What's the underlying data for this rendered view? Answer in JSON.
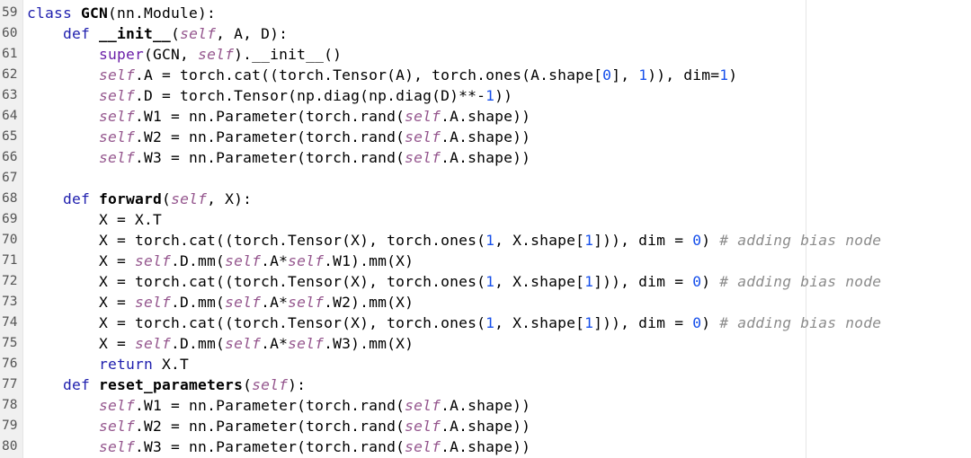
{
  "editor": {
    "language": "python",
    "colors": {
      "keyword": "#1f1fae",
      "builtin": "#6b1fa8",
      "self": "#94558d",
      "number": "#1750eb",
      "comment": "#8c8c8c",
      "text": "#000000",
      "gutter": "#f0f0f0"
    },
    "lines": [
      {
        "no": "59",
        "tokens": [
          [
            "kw",
            "class "
          ],
          [
            "fn",
            "GCN"
          ],
          [
            "pl",
            "(nn.Module):"
          ]
        ]
      },
      {
        "no": "60",
        "tokens": [
          [
            "pl",
            "    "
          ],
          [
            "kw",
            "def "
          ],
          [
            "fn",
            "__init__"
          ],
          [
            "pl",
            "("
          ],
          [
            "sf",
            "self"
          ],
          [
            "pl",
            ", A, D):"
          ]
        ]
      },
      {
        "no": "61",
        "tokens": [
          [
            "pl",
            "        "
          ],
          [
            "bf",
            "super"
          ],
          [
            "pl",
            "(GCN, "
          ],
          [
            "sf",
            "self"
          ],
          [
            "pl",
            ").__init__()"
          ]
        ]
      },
      {
        "no": "62",
        "tokens": [
          [
            "pl",
            "        "
          ],
          [
            "sf",
            "self"
          ],
          [
            "pl",
            ".A = torch.cat((torch.Tensor(A), torch.ones(A.shape["
          ],
          [
            "nm",
            "0"
          ],
          [
            "pl",
            "], "
          ],
          [
            "nm",
            "1"
          ],
          [
            "pl",
            ")), dim="
          ],
          [
            "nm",
            "1"
          ],
          [
            "pl",
            ")"
          ]
        ]
      },
      {
        "no": "63",
        "tokens": [
          [
            "pl",
            "        "
          ],
          [
            "sf",
            "self"
          ],
          [
            "pl",
            ".D = torch.Tensor(np.diag(np.diag(D)**-"
          ],
          [
            "nm",
            "1"
          ],
          [
            "pl",
            "))"
          ]
        ]
      },
      {
        "no": "64",
        "tokens": [
          [
            "pl",
            "        "
          ],
          [
            "sf",
            "self"
          ],
          [
            "pl",
            ".W1 = nn.Parameter(torch.rand("
          ],
          [
            "sf",
            "self"
          ],
          [
            "pl",
            ".A.shape))"
          ]
        ]
      },
      {
        "no": "65",
        "tokens": [
          [
            "pl",
            "        "
          ],
          [
            "sf",
            "self"
          ],
          [
            "pl",
            ".W2 = nn.Parameter(torch.rand("
          ],
          [
            "sf",
            "self"
          ],
          [
            "pl",
            ".A.shape))"
          ]
        ]
      },
      {
        "no": "66",
        "tokens": [
          [
            "pl",
            "        "
          ],
          [
            "sf",
            "self"
          ],
          [
            "pl",
            ".W3 = nn.Parameter(torch.rand("
          ],
          [
            "sf",
            "self"
          ],
          [
            "pl",
            ".A.shape))"
          ]
        ]
      },
      {
        "no": "67",
        "tokens": []
      },
      {
        "no": "68",
        "tokens": [
          [
            "pl",
            "    "
          ],
          [
            "kw",
            "def "
          ],
          [
            "fn",
            "forward"
          ],
          [
            "pl",
            "("
          ],
          [
            "sf",
            "self"
          ],
          [
            "pl",
            ", X):"
          ]
        ]
      },
      {
        "no": "69",
        "tokens": [
          [
            "pl",
            "        X = X.T"
          ]
        ]
      },
      {
        "no": "70",
        "tokens": [
          [
            "pl",
            "        X = torch.cat((torch.Tensor(X), torch.ones("
          ],
          [
            "nm",
            "1"
          ],
          [
            "pl",
            ", X.shape["
          ],
          [
            "nm",
            "1"
          ],
          [
            "pl",
            "])), dim = "
          ],
          [
            "nm",
            "0"
          ],
          [
            "pl",
            ") "
          ],
          [
            "cm",
            "# adding bias node"
          ]
        ]
      },
      {
        "no": "71",
        "tokens": [
          [
            "pl",
            "        X = "
          ],
          [
            "sf",
            "self"
          ],
          [
            "pl",
            ".D.mm("
          ],
          [
            "sf",
            "self"
          ],
          [
            "pl",
            ".A*"
          ],
          [
            "sf",
            "self"
          ],
          [
            "pl",
            ".W1).mm(X)"
          ]
        ]
      },
      {
        "no": "72",
        "tokens": [
          [
            "pl",
            "        X = torch.cat((torch.Tensor(X), torch.ones("
          ],
          [
            "nm",
            "1"
          ],
          [
            "pl",
            ", X.shape["
          ],
          [
            "nm",
            "1"
          ],
          [
            "pl",
            "])), dim = "
          ],
          [
            "nm",
            "0"
          ],
          [
            "pl",
            ") "
          ],
          [
            "cm",
            "# adding bias node"
          ]
        ]
      },
      {
        "no": "73",
        "tokens": [
          [
            "pl",
            "        X = "
          ],
          [
            "sf",
            "self"
          ],
          [
            "pl",
            ".D.mm("
          ],
          [
            "sf",
            "self"
          ],
          [
            "pl",
            ".A*"
          ],
          [
            "sf",
            "self"
          ],
          [
            "pl",
            ".W2).mm(X)"
          ]
        ]
      },
      {
        "no": "74",
        "tokens": [
          [
            "pl",
            "        X = torch.cat((torch.Tensor(X), torch.ones("
          ],
          [
            "nm",
            "1"
          ],
          [
            "pl",
            ", X.shape["
          ],
          [
            "nm",
            "1"
          ],
          [
            "pl",
            "])), dim = "
          ],
          [
            "nm",
            "0"
          ],
          [
            "pl",
            ") "
          ],
          [
            "cm",
            "# adding bias node"
          ]
        ]
      },
      {
        "no": "75",
        "tokens": [
          [
            "pl",
            "        X = "
          ],
          [
            "sf",
            "self"
          ],
          [
            "pl",
            ".D.mm("
          ],
          [
            "sf",
            "self"
          ],
          [
            "pl",
            ".A*"
          ],
          [
            "sf",
            "self"
          ],
          [
            "pl",
            ".W3).mm(X)"
          ]
        ]
      },
      {
        "no": "76",
        "tokens": [
          [
            "pl",
            "        "
          ],
          [
            "kw",
            "return "
          ],
          [
            "pl",
            "X.T"
          ]
        ]
      },
      {
        "no": "77",
        "tokens": [
          [
            "pl",
            "    "
          ],
          [
            "kw",
            "def "
          ],
          [
            "fn",
            "reset_parameters"
          ],
          [
            "pl",
            "("
          ],
          [
            "sf",
            "self"
          ],
          [
            "pl",
            "):"
          ]
        ]
      },
      {
        "no": "78",
        "tokens": [
          [
            "pl",
            "        "
          ],
          [
            "sf",
            "self"
          ],
          [
            "pl",
            ".W1 = nn.Parameter(torch.rand("
          ],
          [
            "sf",
            "self"
          ],
          [
            "pl",
            ".A.shape))"
          ]
        ]
      },
      {
        "no": "79",
        "tokens": [
          [
            "pl",
            "        "
          ],
          [
            "sf",
            "self"
          ],
          [
            "pl",
            ".W2 = nn.Parameter(torch.rand("
          ],
          [
            "sf",
            "self"
          ],
          [
            "pl",
            ".A.shape))"
          ]
        ]
      },
      {
        "no": "80",
        "tokens": [
          [
            "pl",
            "        "
          ],
          [
            "sf",
            "self"
          ],
          [
            "pl",
            ".W3 = nn.Parameter(torch.rand("
          ],
          [
            "sf",
            "self"
          ],
          [
            "pl",
            ".A.shape))"
          ]
        ]
      }
    ]
  }
}
